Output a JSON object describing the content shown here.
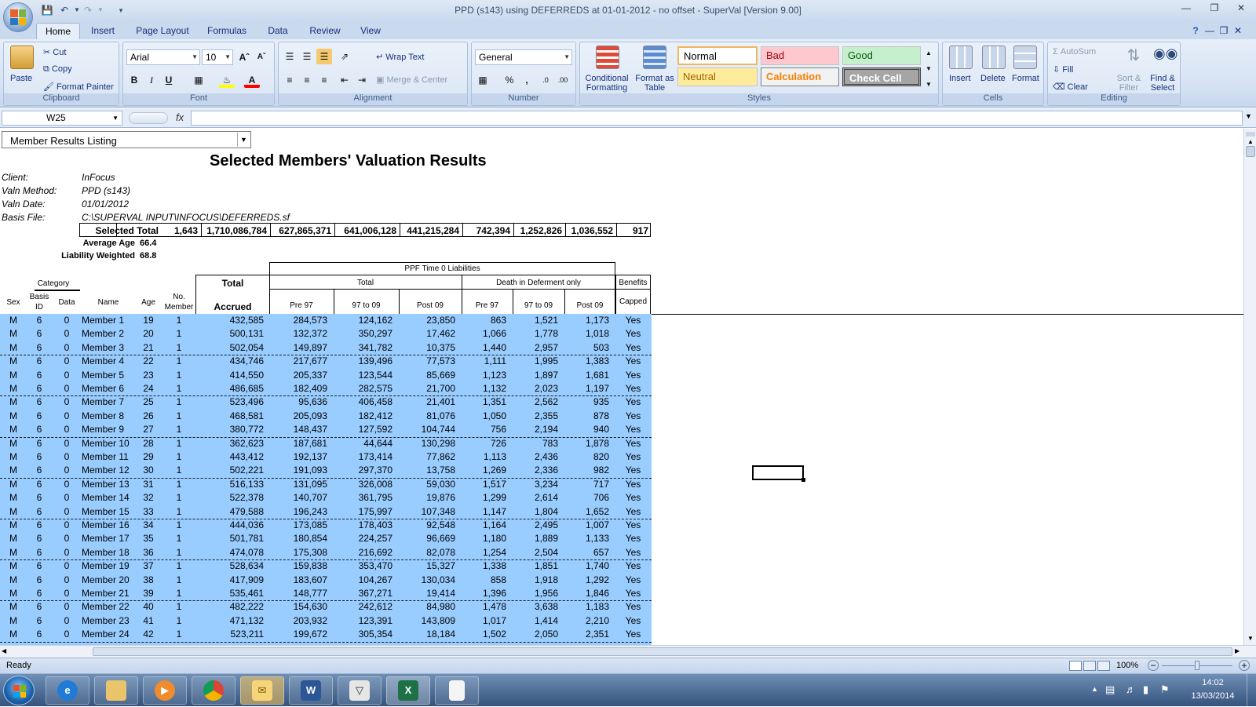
{
  "window": {
    "title": "PPD (s143) using DEFERREDS at 01-01-2012 - no offset - SuperVal [Version 9.00]"
  },
  "tabs": [
    "Home",
    "Insert",
    "Page Layout",
    "Formulas",
    "Data",
    "Review",
    "View"
  ],
  "ribbon": {
    "clipboard": {
      "paste": "Paste",
      "cut": "Cut",
      "copy": "Copy",
      "format_painter": "Format Painter",
      "label": "Clipboard"
    },
    "font": {
      "name": "Arial",
      "size": "10",
      "label": "Font",
      "bold": "B",
      "italic": "I",
      "underline": "U"
    },
    "alignment": {
      "wrap_text": "Wrap Text",
      "merge_center": "Merge & Center",
      "label": "Alignment"
    },
    "number": {
      "format": "General",
      "label": "Number",
      "percent": "%",
      "comma": ","
    },
    "styles": {
      "conditional_formatting": "Conditional Formatting",
      "format_as_table": "Format as Table",
      "label": "Styles",
      "cells": [
        {
          "name": "Normal",
          "bg": "#ffffff",
          "color": "#000000"
        },
        {
          "name": "Bad",
          "bg": "#ffc7ce",
          "color": "#9c0006"
        },
        {
          "name": "Good",
          "bg": "#c6efce",
          "color": "#006100"
        },
        {
          "name": "Neutral",
          "bg": "#ffeb9c",
          "color": "#9c6500"
        },
        {
          "name": "Calculation",
          "bg": "#f2f2f2",
          "color": "#fa7d00"
        },
        {
          "name": "Check Cell",
          "bg": "#a5a5a5",
          "color": "#ffffff"
        }
      ]
    },
    "cells": {
      "insert": "Insert",
      "delete": "Delete",
      "format": "Format",
      "label": "Cells"
    },
    "editing": {
      "autosum": "AutoSum",
      "fill": "Fill",
      "clear": "Clear",
      "sort_filter": "Sort & Filter",
      "find_select": "Find & Select",
      "label": "Editing"
    }
  },
  "formula_bar": {
    "name_box": "W25",
    "fx": "fx",
    "value": ""
  },
  "sheet": {
    "dropdown": "Member Results Listing",
    "title": "Selected Members' Valuation Results",
    "info": [
      {
        "label": "Client:",
        "value": "InFocus"
      },
      {
        "label": "Valn Method:",
        "value": "PPD  (s143)"
      },
      {
        "label": "Valn Date:",
        "value": "01/01/2012"
      },
      {
        "label": "Basis File:",
        "value": "C:\\SUPERVAL INPUT\\INFOCUS\\DEFERREDS.sf"
      }
    ],
    "selected_total": {
      "label": "Selected Total",
      "values": [
        "1,643",
        "1,710,086,784",
        "627,865,371",
        "641,006,128",
        "441,215,284",
        "742,394",
        "1,252,826",
        "1,036,552",
        "917"
      ]
    },
    "average_age": {
      "label": "Average Age",
      "value": "66.4"
    },
    "liability_weighted": {
      "label": "Liability Weighted",
      "value": "68.8"
    },
    "headers": {
      "ppf": "PPF Time 0 Liabilities",
      "total_group": "Total",
      "death_group": "Death in Deferment only",
      "benefits": "Benefits",
      "capped": "Capped",
      "total": "Total",
      "accrued": "Accrued",
      "category": "Category",
      "sex": "Sex",
      "basis_id": "Basis ID",
      "data": "Data",
      "name": "Name",
      "age": "Age",
      "no_member": "No. Member",
      "pre97": "Pre 97",
      "t97to09": "97 to 09",
      "post09": "Post 09"
    },
    "rows": [
      [
        "M",
        "6",
        "0",
        "Member 1",
        "19",
        "1",
        "432,585",
        "284,573",
        "124,162",
        "23,850",
        "863",
        "1,521",
        "1,173",
        "Yes"
      ],
      [
        "M",
        "6",
        "0",
        "Member 2",
        "20",
        "1",
        "500,131",
        "132,372",
        "350,297",
        "17,462",
        "1,066",
        "1,778",
        "1,018",
        "Yes"
      ],
      [
        "M",
        "6",
        "0",
        "Member 3",
        "21",
        "1",
        "502,054",
        "149,897",
        "341,782",
        "10,375",
        "1,440",
        "2,957",
        "503",
        "Yes"
      ],
      [
        "M",
        "6",
        "0",
        "Member 4",
        "22",
        "1",
        "434,746",
        "217,677",
        "139,496",
        "77,573",
        "1,111",
        "1,995",
        "1,383",
        "Yes"
      ],
      [
        "M",
        "6",
        "0",
        "Member 5",
        "23",
        "1",
        "414,550",
        "205,337",
        "123,544",
        "85,669",
        "1,123",
        "1,897",
        "1,681",
        "Yes"
      ],
      [
        "M",
        "6",
        "0",
        "Member 6",
        "24",
        "1",
        "486,685",
        "182,409",
        "282,575",
        "21,700",
        "1,132",
        "2,023",
        "1,197",
        "Yes"
      ],
      [
        "M",
        "6",
        "0",
        "Member 7",
        "25",
        "1",
        "523,496",
        "95,636",
        "406,458",
        "21,401",
        "1,351",
        "2,562",
        "935",
        "Yes"
      ],
      [
        "M",
        "6",
        "0",
        "Member 8",
        "26",
        "1",
        "468,581",
        "205,093",
        "182,412",
        "81,076",
        "1,050",
        "2,355",
        "878",
        "Yes"
      ],
      [
        "M",
        "6",
        "0",
        "Member 9",
        "27",
        "1",
        "380,772",
        "148,437",
        "127,592",
        "104,744",
        "756",
        "2,194",
        "940",
        "Yes"
      ],
      [
        "M",
        "6",
        "0",
        "Member 10",
        "28",
        "1",
        "362,623",
        "187,681",
        "44,644",
        "130,298",
        "726",
        "783",
        "1,878",
        "Yes"
      ],
      [
        "M",
        "6",
        "0",
        "Member 11",
        "29",
        "1",
        "443,412",
        "192,137",
        "173,414",
        "77,862",
        "1,113",
        "2,436",
        "820",
        "Yes"
      ],
      [
        "M",
        "6",
        "0",
        "Member 12",
        "30",
        "1",
        "502,221",
        "191,093",
        "297,370",
        "13,758",
        "1,269",
        "2,336",
        "982",
        "Yes"
      ],
      [
        "M",
        "6",
        "0",
        "Member 13",
        "31",
        "1",
        "516,133",
        "131,095",
        "326,008",
        "59,030",
        "1,517",
        "3,234",
        "717",
        "Yes"
      ],
      [
        "M",
        "6",
        "0",
        "Member 14",
        "32",
        "1",
        "522,378",
        "140,707",
        "361,795",
        "19,876",
        "1,299",
        "2,614",
        "706",
        "Yes"
      ],
      [
        "M",
        "6",
        "0",
        "Member 15",
        "33",
        "1",
        "479,588",
        "196,243",
        "175,997",
        "107,348",
        "1,147",
        "1,804",
        "1,652",
        "Yes"
      ],
      [
        "M",
        "6",
        "0",
        "Member 16",
        "34",
        "1",
        "444,036",
        "173,085",
        "178,403",
        "92,548",
        "1,164",
        "2,495",
        "1,007",
        "Yes"
      ],
      [
        "M",
        "6",
        "0",
        "Member 17",
        "35",
        "1",
        "501,781",
        "180,854",
        "224,257",
        "96,669",
        "1,180",
        "1,889",
        "1,133",
        "Yes"
      ],
      [
        "M",
        "6",
        "0",
        "Member 18",
        "36",
        "1",
        "474,078",
        "175,308",
        "216,692",
        "82,078",
        "1,254",
        "2,504",
        "657",
        "Yes"
      ],
      [
        "M",
        "6",
        "0",
        "Member 19",
        "37",
        "1",
        "528,634",
        "159,838",
        "353,470",
        "15,327",
        "1,338",
        "1,851",
        "1,740",
        "Yes"
      ],
      [
        "M",
        "6",
        "0",
        "Member 20",
        "38",
        "1",
        "417,909",
        "183,607",
        "104,267",
        "130,034",
        "858",
        "1,918",
        "1,292",
        "Yes"
      ],
      [
        "M",
        "6",
        "0",
        "Member 21",
        "39",
        "1",
        "535,461",
        "148,777",
        "367,271",
        "19,414",
        "1,396",
        "1,956",
        "1,846",
        "Yes"
      ],
      [
        "M",
        "6",
        "0",
        "Member 22",
        "40",
        "1",
        "482,222",
        "154,630",
        "242,612",
        "84,980",
        "1,478",
        "3,638",
        "1,183",
        "Yes"
      ],
      [
        "M",
        "6",
        "0",
        "Member 23",
        "41",
        "1",
        "471,132",
        "203,932",
        "123,391",
        "143,809",
        "1,017",
        "1,414",
        "2,210",
        "Yes"
      ],
      [
        "M",
        "6",
        "0",
        "Member 24",
        "42",
        "1",
        "523,211",
        "199,672",
        "305,354",
        "18,184",
        "1,502",
        "2,050",
        "2,351",
        "Yes"
      ]
    ]
  },
  "status": {
    "text": "Ready",
    "zoom": "100%"
  },
  "clock": {
    "time": "14:02",
    "date": "13/03/2014"
  }
}
